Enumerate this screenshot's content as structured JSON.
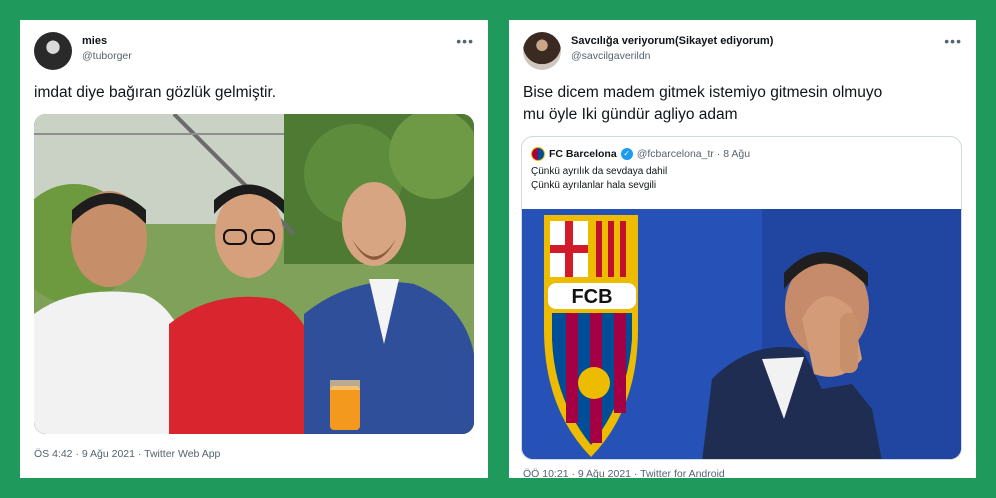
{
  "left_tweet": {
    "display_name": "mies",
    "handle": "@tuborger",
    "more_label": "•••",
    "text": "imdat diye bağıran gözlük gelmiştir.",
    "meta": "ÖS 4:42 · 9 Ağu 2021 · Twitter Web App"
  },
  "right_tweet": {
    "display_name": "Savcılığa veriyorum(Sikayet ediyorum)",
    "handle": "@savcilgaverildn",
    "more_label": "•••",
    "text_line1": "Bise dicem madem gitmek istemiyo gitmesin olmuyo",
    "text_line2": "mu öyle Iki gündür agliyo adam",
    "meta": "ÖÖ 10:21 · 9 Ağu 2021 · Twitter for Android",
    "quote": {
      "name": "FC Barcelona",
      "handle": "@fcbarcelona_tr · 8 Ağu",
      "line1": "Çünkü ayrılık da sevdaya dahil",
      "line2": "Çünkü ayrılanlar hala sevgili",
      "crest_text": "FCB"
    }
  },
  "colors": {
    "background": "#1f9a5c",
    "card": "#ffffff",
    "secondary_text": "#536471",
    "verified": "#1d9bf0"
  },
  "icons": [
    "more-options-icon",
    "verified-badge-icon"
  ]
}
